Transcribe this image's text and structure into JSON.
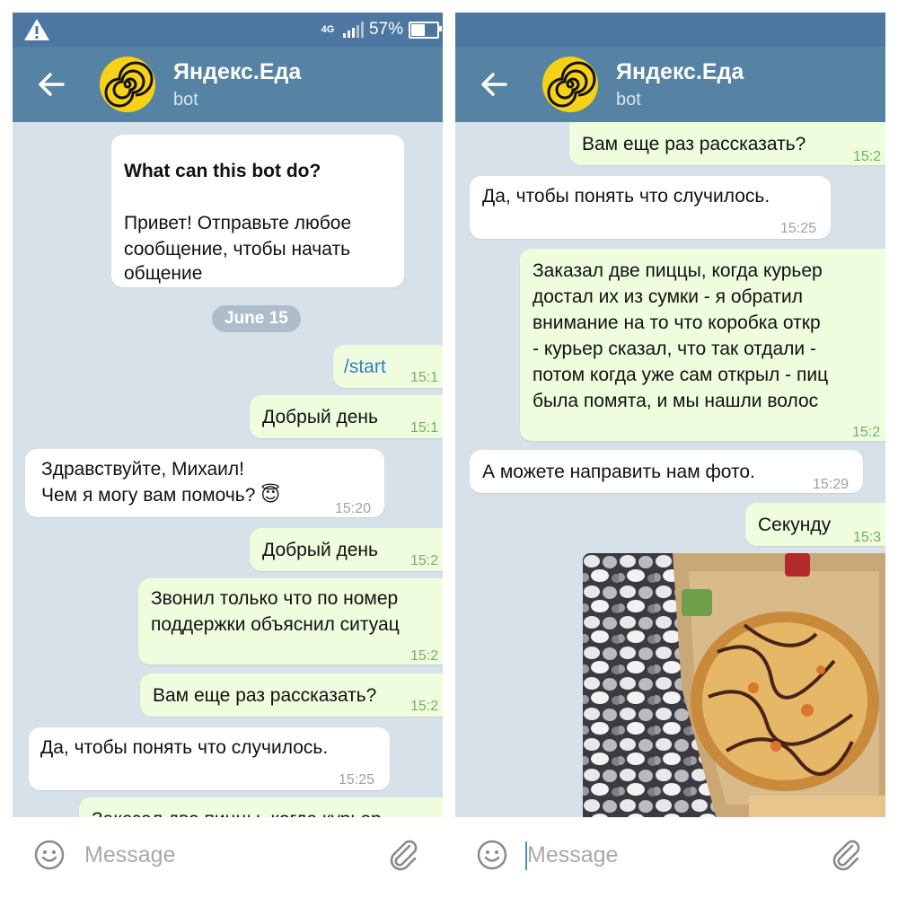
{
  "status": {
    "network": "4G",
    "battery": "57%",
    "battery_level": 0.57
  },
  "chat": {
    "title": "Яндекс.Еда",
    "subtitle": "bot"
  },
  "input": {
    "placeholder": "Message"
  },
  "left": {
    "intro": {
      "title": "What can this bot do?",
      "line1": "Привет! Отправьте любое",
      "line2": "сообщение, чтобы начать",
      "line3": "общение"
    },
    "date": "June 15",
    "m1": {
      "text": "/start",
      "time": "15:1"
    },
    "m2": {
      "text": "Добрый день",
      "time": "15:1"
    },
    "m3": {
      "line1": "Здравствуйте, Михаил!",
      "line2": "Чем я могу вам помочь?",
      "emoji": "😇",
      "time": "15:20"
    },
    "m4": {
      "text": "Добрый день",
      "time": "15:2"
    },
    "m5": {
      "line1": "Звонил только что по номер",
      "line2": "поддержки объяснил ситуац",
      "time": "15:2"
    },
    "m6": {
      "text": "Вам еще раз рассказать?",
      "time": "15:2"
    },
    "m7": {
      "text": "Да, чтобы понять что случилось.",
      "time": "15:25"
    },
    "m8": {
      "text": "Заказал две пиццы, когда курьер"
    }
  },
  "right": {
    "m1": {
      "text": "Вам еще раз рассказать?",
      "time": "15:2"
    },
    "m2": {
      "text": "Да, чтобы понять что случилось.",
      "time": "15:25"
    },
    "m3": {
      "line1": "Заказал две пиццы, когда курьер",
      "line2": "достал их из сумки - я обратил",
      "line3": "внимание на то что коробка откр",
      "line4": "- курьер сказал, что так отдали -",
      "line5": "потом когда уже сам открыл - пиц",
      "line6": "была помята, и мы нашли волос",
      "time": "15:2"
    },
    "m4": {
      "text": "А можете направить нам фото.",
      "time": "15:29"
    },
    "m5": {
      "text": "Секунду",
      "time": "15:3"
    }
  }
}
